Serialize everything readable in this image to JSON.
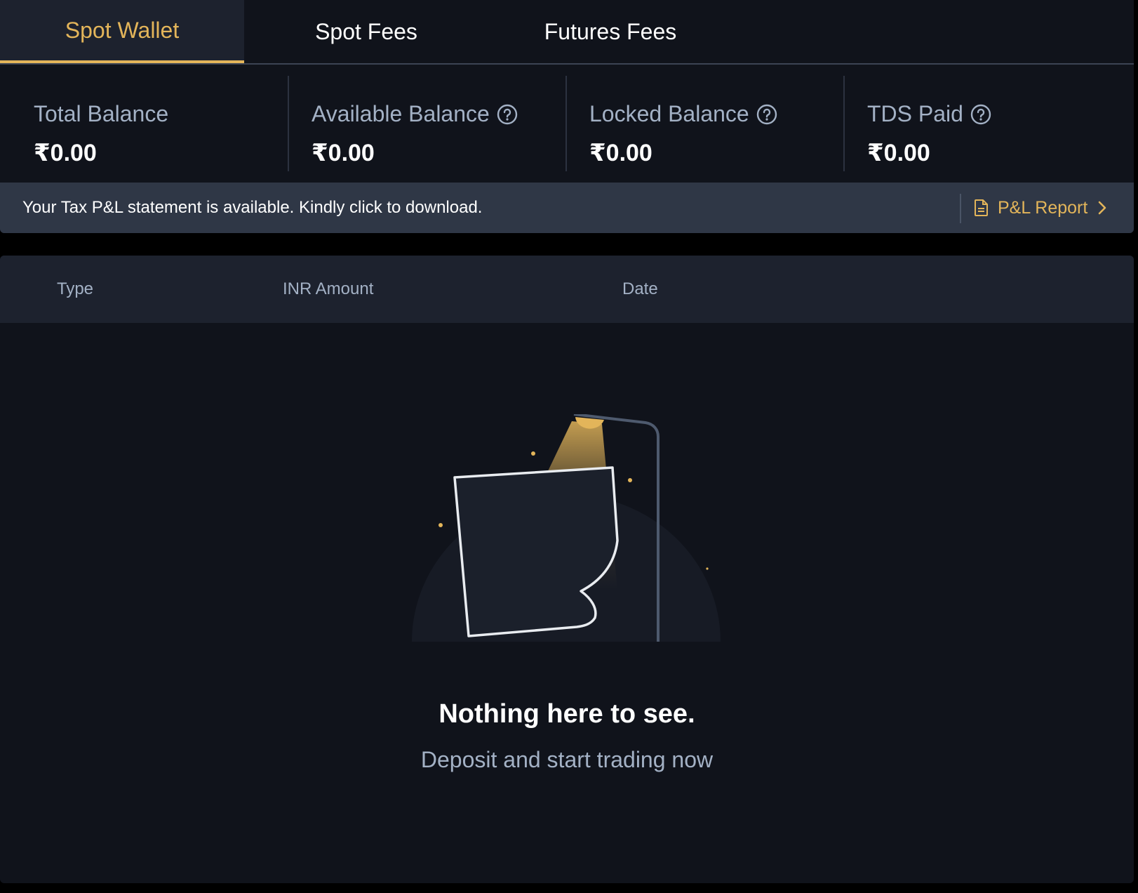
{
  "tabs": [
    {
      "label": "Spot Wallet",
      "active": true
    },
    {
      "label": "Spot Fees",
      "active": false
    },
    {
      "label": "Futures Fees",
      "active": false
    }
  ],
  "balances": [
    {
      "title": "Total Balance",
      "value": "₹0.00",
      "has_help": false
    },
    {
      "title": "Available Balance",
      "value": "₹0.00",
      "has_help": true
    },
    {
      "title": "Locked Balance",
      "value": "₹0.00",
      "has_help": true
    },
    {
      "title": "TDS Paid",
      "value": "₹0.00",
      "has_help": true
    }
  ],
  "banner": {
    "text": "Your Tax P&L statement is available. Kindly click to download.",
    "report_label": "P&L Report",
    "report_icon": "document-icon",
    "chevron_icon": "chevron-right-icon"
  },
  "table": {
    "columns": [
      "Type",
      "INR Amount",
      "Date"
    ],
    "rows": []
  },
  "empty_state": {
    "title": "Nothing here to see.",
    "subtitle": "Deposit and start trading now",
    "illustration": "lamp-and-paper-illustration"
  },
  "colors": {
    "accent": "#e3b55a",
    "background": "#10131b",
    "header_bg": "#1d222e",
    "banner_bg": "#2f3746",
    "muted_text": "#a3b1c5"
  }
}
